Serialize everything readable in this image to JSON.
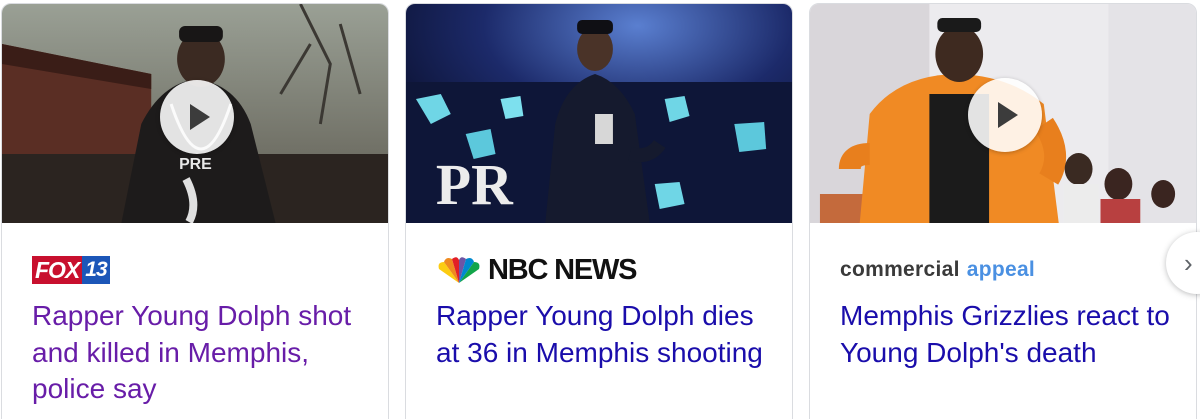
{
  "carousel": {
    "cards": [
      {
        "source": {
          "logo_word": "FOX",
          "logo_number": "13"
        },
        "headline": "Rapper Young Dolph shot and killed in Memphis, police say",
        "has_video": true,
        "visited": true,
        "thumbnail_icon": "person-photo-icon"
      },
      {
        "source": {
          "logo_text": "NBC NEWS"
        },
        "headline": "Rapper Young Dolph dies at 36 in Memphis shooting",
        "has_video": false,
        "visited": false,
        "thumbnail_icon": "person-photo-icon"
      },
      {
        "source": {
          "logo_part1": "commercial",
          "logo_part2": "appeal"
        },
        "headline": "Memphis Grizzlies react to Young Dolph's death",
        "has_video": true,
        "visited": false,
        "thumbnail_icon": "person-photo-icon"
      }
    ],
    "next_button": {
      "icon": "chevron-right-icon",
      "label": "›"
    }
  },
  "colors": {
    "visited_link": "#681da8",
    "link": "#1a0dab",
    "card_border": "#dadce0",
    "fox_red": "#c8102e",
    "fox_blue": "#1c56b8",
    "commercial_appeal_blue": "#4a90e2"
  }
}
